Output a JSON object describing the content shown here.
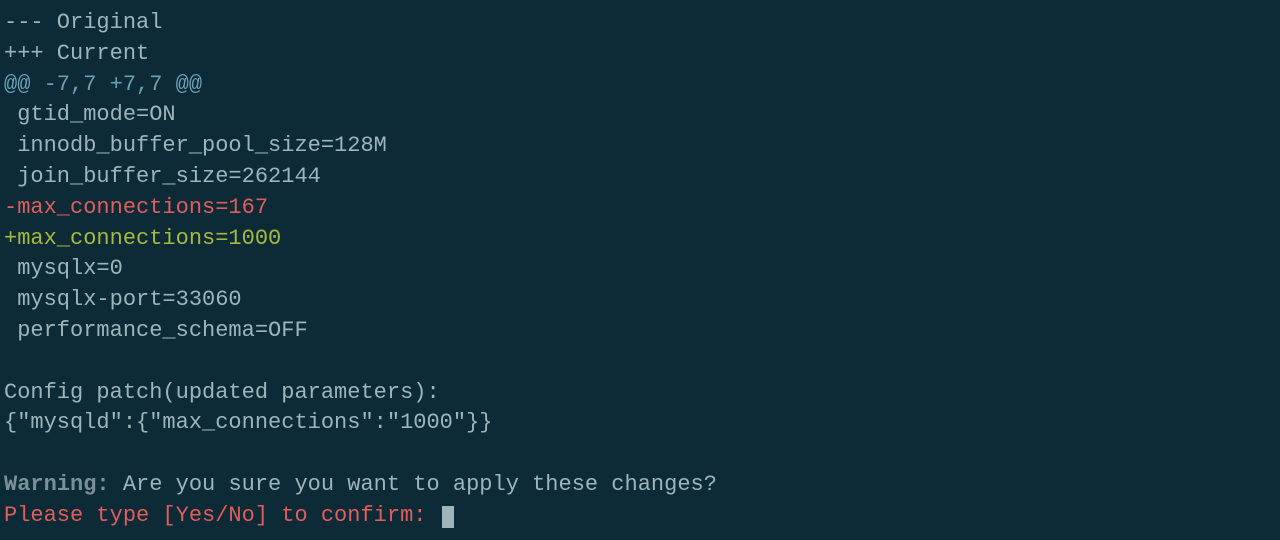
{
  "diff": {
    "header_original": "--- Original",
    "header_current": "+++ Current",
    "hunk": "@@ -7,7 +7,7 @@",
    "context1": " gtid_mode=ON",
    "context2": " innodb_buffer_pool_size=128M",
    "context3": " join_buffer_size=262144",
    "removed": "-max_connections=167",
    "added": "+max_connections=1000",
    "context4": " mysqlx=0",
    "context5": " mysqlx-port=33060",
    "context6": " performance_schema=OFF"
  },
  "config_patch": {
    "label": "Config patch(updated parameters):",
    "json": "{\"mysqld\":{\"max_connections\":\"1000\"}}"
  },
  "warning": {
    "label": "Warning:",
    "text": " Are you sure you want to apply these changes?"
  },
  "prompt": {
    "text": "Please type [Yes/No] to confirm: "
  }
}
